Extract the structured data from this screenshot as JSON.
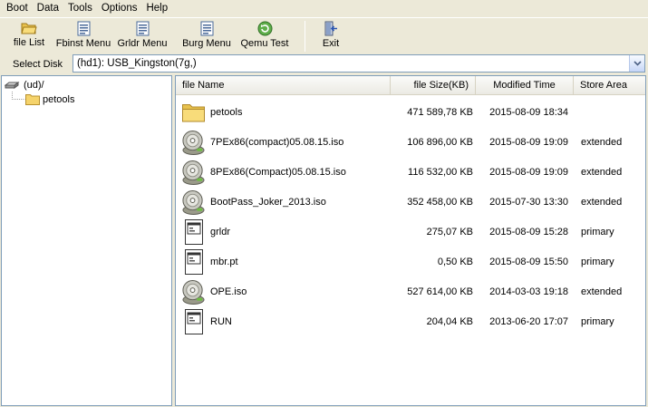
{
  "menu": [
    "Boot",
    "Data",
    "Tools",
    "Options",
    "Help"
  ],
  "toolbar": {
    "file_list": "file List",
    "fbinst_menu": "Fbinst Menu",
    "grldr_menu": "Grldr Menu",
    "burg_menu": "Burg Menu",
    "qemu_test": "Qemu Test",
    "exit": "Exit"
  },
  "disk": {
    "label": "Select Disk",
    "value": "(hd1): USB_Kingston(7g,)"
  },
  "tree": {
    "root": "(ud)/",
    "child": "petools"
  },
  "list": {
    "columns": [
      "file Name",
      "file Size(KB)",
      "Modified Time",
      "Store Area"
    ],
    "rows": [
      {
        "name": "petools",
        "size": "471 589,78 KB",
        "modified": "2015-08-09 18:34",
        "store": "",
        "icon": "folder-icon"
      },
      {
        "name": "7PEx86(compact)05.08.15.iso",
        "size": "106 896,00 KB",
        "modified": "2015-08-09 19:09",
        "store": "extended",
        "icon": "disc-image-icon"
      },
      {
        "name": "8PEx86(Compact)05.08.15.iso",
        "size": "116 532,00 KB",
        "modified": "2015-08-09 19:09",
        "store": "extended",
        "icon": "disc-image-icon"
      },
      {
        "name": "BootPass_Joker_2013.iso",
        "size": "352 458,00 KB",
        "modified": "2015-07-30 13:30",
        "store": "extended",
        "icon": "disc-image-icon"
      },
      {
        "name": "grldr",
        "size": "275,07 KB",
        "modified": "2015-08-09 15:28",
        "store": "primary",
        "icon": "file-icon"
      },
      {
        "name": "mbr.pt",
        "size": "0,50 KB",
        "modified": "2015-08-09 15:50",
        "store": "primary",
        "icon": "file-icon"
      },
      {
        "name": "OPE.iso",
        "size": "527 614,00 KB",
        "modified": "2014-03-03 19:18",
        "store": "extended",
        "icon": "disc-image-icon"
      },
      {
        "name": "RUN",
        "size": "204,04 KB",
        "modified": "2013-06-20 17:07",
        "store": "primary",
        "icon": "file-icon"
      }
    ]
  },
  "colors": {
    "window_bg": "#ece9d8",
    "border": "#7f9db9",
    "folder": "#f5d36b"
  }
}
